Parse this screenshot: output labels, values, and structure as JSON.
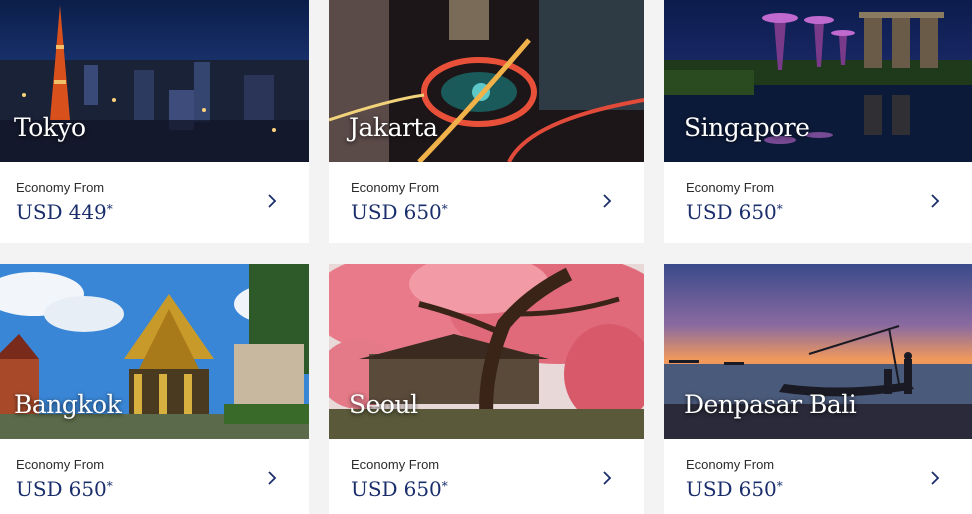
{
  "cards": [
    {
      "city": "Tokyo",
      "fare_label": "Economy From",
      "currency": "USD",
      "amount": "449",
      "note": "*"
    },
    {
      "city": "Jakarta",
      "fare_label": "Economy From",
      "currency": "USD",
      "amount": "650",
      "note": "*"
    },
    {
      "city": "Singapore",
      "fare_label": "Economy From",
      "currency": "USD",
      "amount": "650",
      "note": "*"
    },
    {
      "city": "Bangkok",
      "fare_label": "Economy From",
      "currency": "USD",
      "amount": "650",
      "note": "*"
    },
    {
      "city": "Seoul",
      "fare_label": "Economy From",
      "currency": "USD",
      "amount": "650",
      "note": "*"
    },
    {
      "city": "Denpasar Bali",
      "fare_label": "Economy From",
      "currency": "USD",
      "amount": "650",
      "note": "*"
    }
  ],
  "colors": {
    "price": "#1a2e6c",
    "chevron": "#1a2e6c",
    "page_bg": "#f3f3f3"
  },
  "icons": {
    "chevron": "chevron-right-icon"
  }
}
